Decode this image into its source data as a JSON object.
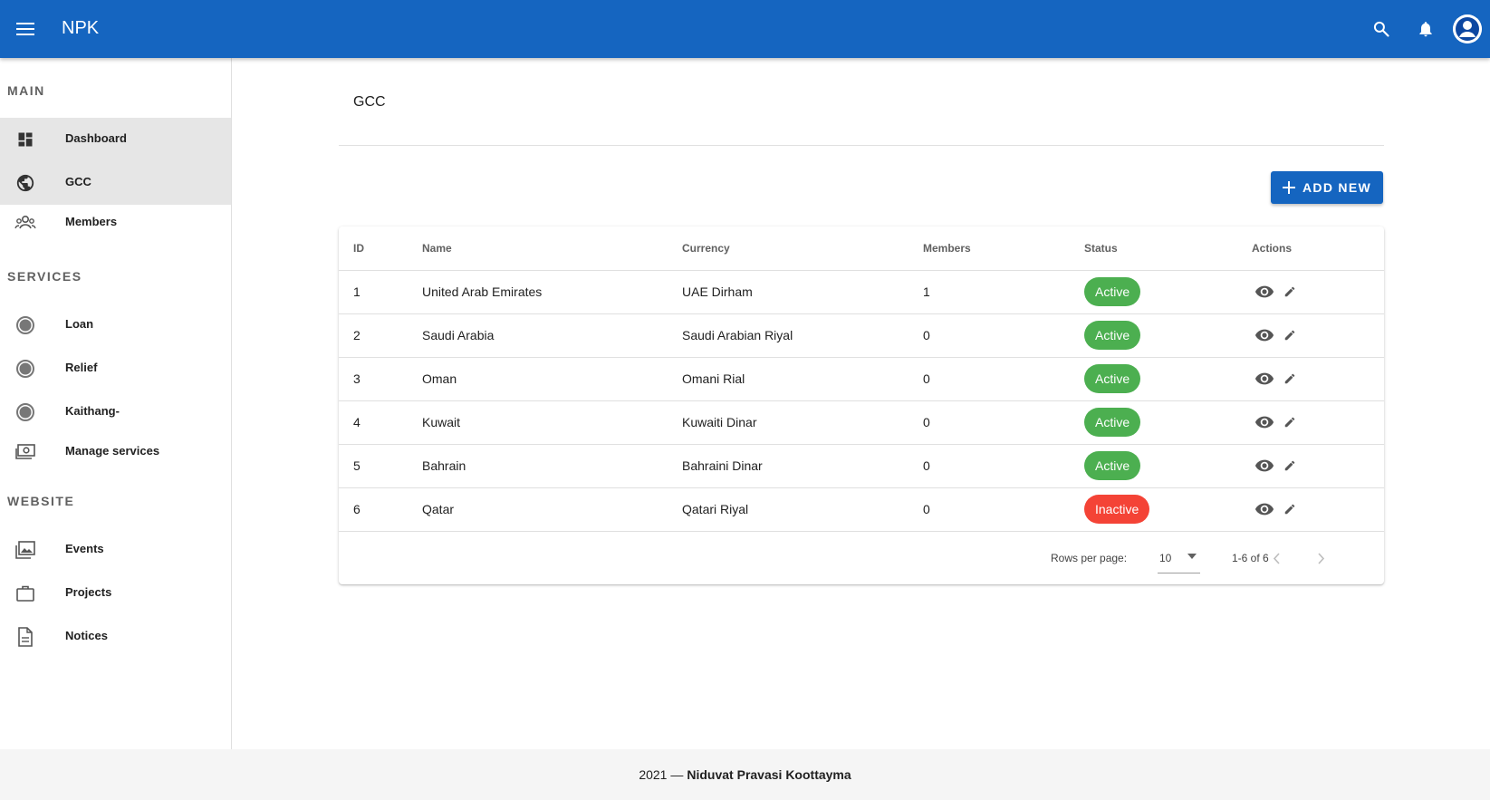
{
  "app": {
    "title": "NPK"
  },
  "sidebar": {
    "sections": [
      {
        "header": "MAIN",
        "items": [
          {
            "label": "Dashboard",
            "icon": "dashboard-icon"
          },
          {
            "label": "GCC",
            "icon": "globe-icon"
          },
          {
            "label": "Members",
            "icon": "people-icon"
          }
        ]
      },
      {
        "header": "SERVICES",
        "items": [
          {
            "label": "Loan",
            "icon": "circle-icon"
          },
          {
            "label": "Relief",
            "icon": "circle-icon"
          },
          {
            "label": "Kaithang-",
            "icon": "circle-icon"
          },
          {
            "label": "Manage services",
            "icon": "money-icon"
          }
        ]
      },
      {
        "header": "WEBSITE",
        "items": [
          {
            "label": "Events",
            "icon": "photo-library-icon"
          },
          {
            "label": "Projects",
            "icon": "briefcase-icon"
          },
          {
            "label": "Notices",
            "icon": "document-icon"
          }
        ]
      }
    ]
  },
  "page": {
    "title": "GCC",
    "add_button": "ADD NEW"
  },
  "table": {
    "columns": [
      "ID",
      "Name",
      "Currency",
      "Members",
      "Status",
      "Actions"
    ],
    "rows": [
      {
        "id": "1",
        "name": "United Arab Emirates",
        "currency": "UAE Dirham",
        "members": "1",
        "status": "Active"
      },
      {
        "id": "2",
        "name": "Saudi Arabia",
        "currency": "Saudi Arabian Riyal",
        "members": "0",
        "status": "Active"
      },
      {
        "id": "3",
        "name": "Oman",
        "currency": "Omani Rial",
        "members": "0",
        "status": "Active"
      },
      {
        "id": "4",
        "name": "Kuwait",
        "currency": "Kuwaiti Dinar",
        "members": "0",
        "status": "Active"
      },
      {
        "id": "5",
        "name": "Bahrain",
        "currency": "Bahraini Dinar",
        "members": "0",
        "status": "Active"
      },
      {
        "id": "6",
        "name": "Qatar",
        "currency": "Qatari Riyal",
        "members": "0",
        "status": "Inactive"
      }
    ],
    "pagination": {
      "rows_per_page_label": "Rows per page:",
      "rows_per_page": "10",
      "range": "1-6 of 6"
    }
  },
  "footer": {
    "year": "2021 —",
    "org": "Niduvat Pravasi Koottayma"
  },
  "colors": {
    "primary": "#1565c0",
    "active": "#4caf50",
    "inactive": "#f44336"
  }
}
